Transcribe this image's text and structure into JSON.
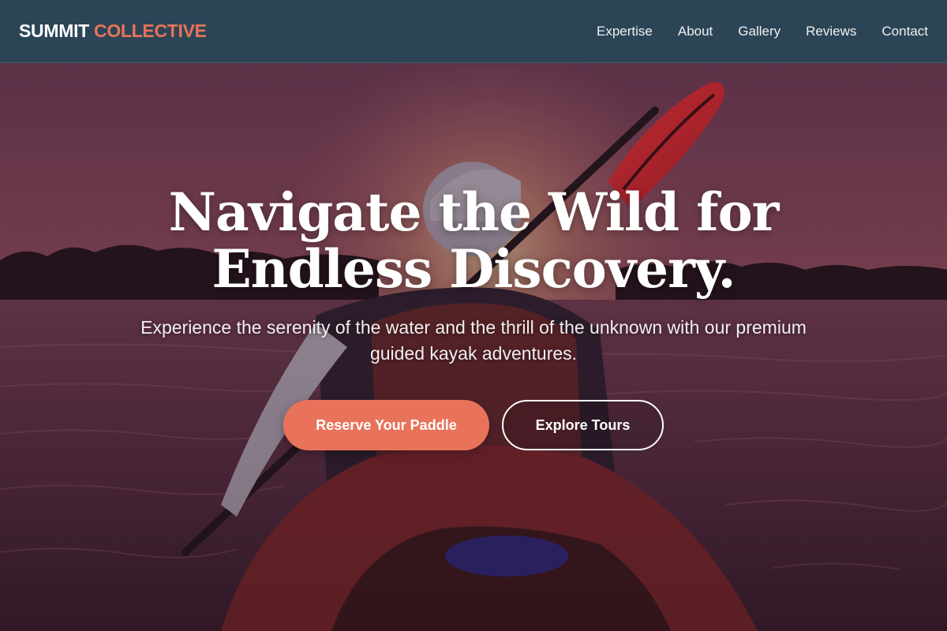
{
  "brand": {
    "name_part1": "SUMMIT",
    "name_part2": "COLLECTIVE"
  },
  "nav": {
    "items": [
      {
        "label": "Expertise"
      },
      {
        "label": "About"
      },
      {
        "label": "Gallery"
      },
      {
        "label": "Reviews"
      },
      {
        "label": "Contact"
      }
    ]
  },
  "hero": {
    "title_line1": "Navigate the Wild for",
    "title_line2": "Endless Discovery.",
    "subtitle": "Experience the serenity of the water and the thrill of the unknown with our premium guided kayak adventures.",
    "primary_cta": "Reserve Your Paddle",
    "secondary_cta": "Explore Tours"
  },
  "colors": {
    "nav_background": "#2c4556",
    "accent": "#e8735a",
    "text": "#ffffff"
  }
}
